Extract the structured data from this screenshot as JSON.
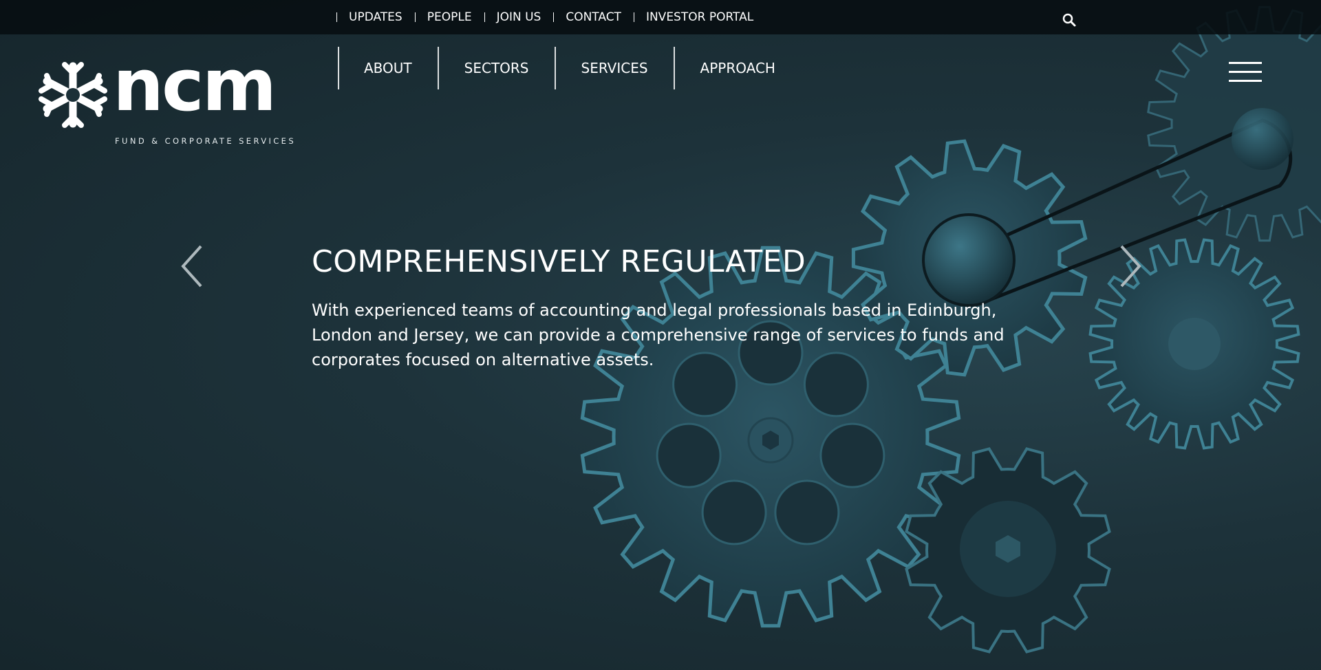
{
  "topbar": {
    "links": [
      "UPDATES",
      "PEOPLE",
      "JOIN US",
      "CONTACT",
      "INVESTOR PORTAL"
    ]
  },
  "logo": {
    "wordmark": "ncm",
    "tagline": "FUND & CORPORATE SERVICES"
  },
  "nav": {
    "items": [
      "ABOUT",
      "SECTORS",
      "SERVICES",
      "APPROACH"
    ]
  },
  "slide": {
    "title": "COMPREHENSIVELY REGULATED",
    "body": "With experienced teams of accounting and legal professionals based in Edinburgh, London and Jersey, we can provide a comprehensive range of services to funds and corporates focused on alternative assets."
  },
  "icons": {
    "search": "search-icon",
    "menu": "hamburger-menu-icon",
    "prev": "chevron-left-icon",
    "next": "chevron-right-icon",
    "logo_mark": "snowflake-logo-icon"
  },
  "colors": {
    "background": "#1b3038",
    "gear_outline": "#3f8294",
    "gear_fill": "#1f3e49",
    "topbar": "#070e11"
  }
}
